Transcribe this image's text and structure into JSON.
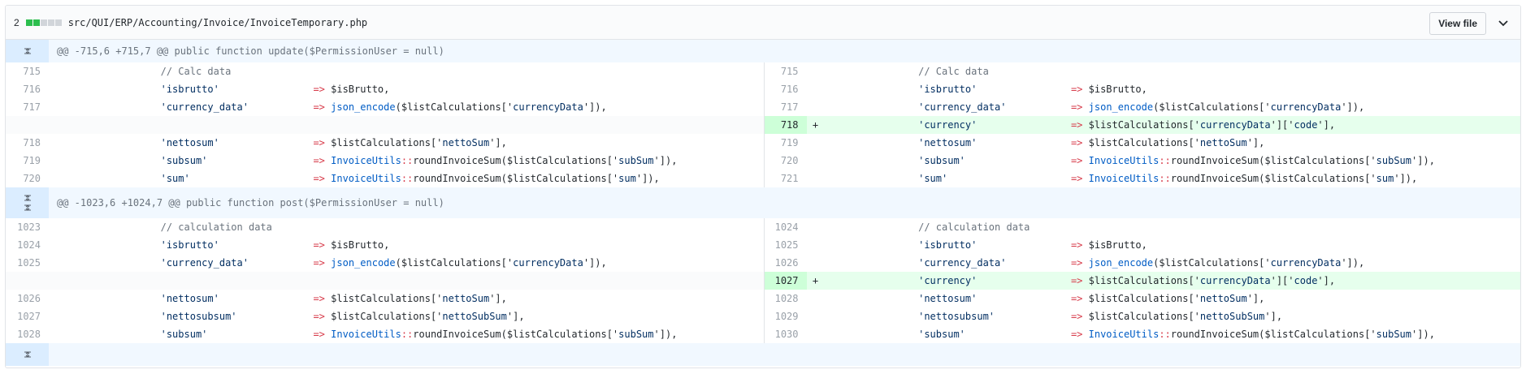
{
  "file": {
    "change_count": "2",
    "path": "src/QUI/ERP/Accounting/Invoice/InvoiceTemporary.php",
    "view_file_label": "View file",
    "diffstat": [
      "#2cbe4e",
      "#2cbe4e",
      "#d1d5da",
      "#d1d5da",
      "#d1d5da"
    ]
  },
  "hunks": [
    {
      "header": "@@ -715,6 +715,7 @@ public function update($PermissionUser = null)",
      "rows": [
        {
          "l": "715",
          "r": "715",
          "key": "",
          "comment": "// Calc data",
          "type": "ctx"
        },
        {
          "l": "716",
          "r": "716",
          "key": "'isbrutto'",
          "val": "$isBrutto,",
          "type": "ctx"
        },
        {
          "l": "717",
          "r": "717",
          "key": "'currency_data'",
          "fn": "json_encode",
          "val": "($listCalculations['",
          "strv": "currencyData",
          "tail": "']),",
          "type": "ctx"
        },
        {
          "l": "",
          "r": "718",
          "key": "'currency'",
          "val": "$listCalculations['",
          "strv": "currencyData",
          "tail": "']['",
          "strv2": "code",
          "tail2": "'],",
          "type": "add"
        },
        {
          "l": "718",
          "r": "719",
          "key": "'nettosum'",
          "val": "$listCalculations['",
          "strv": "nettoSum",
          "tail": "'],",
          "type": "ctx"
        },
        {
          "l": "719",
          "r": "720",
          "key": "'subsum'",
          "cls": "InvoiceUtils",
          "val": "roundInvoiceSum($listCalculations['",
          "strv": "subSum",
          "tail": "']),",
          "type": "ctx"
        },
        {
          "l": "720",
          "r": "721",
          "key": "'sum'",
          "cls": "InvoiceUtils",
          "val": "roundInvoiceSum($listCalculations['",
          "strv": "sum",
          "tail": "']),",
          "type": "ctx"
        }
      ]
    },
    {
      "header": "@@ -1023,6 +1024,7 @@ public function post($PermissionUser = null)",
      "rows": [
        {
          "l": "1023",
          "r": "1024",
          "key": "",
          "comment": "// calculation data",
          "type": "ctx"
        },
        {
          "l": "1024",
          "r": "1025",
          "key": "'isbrutto'",
          "val": "$isBrutto,",
          "type": "ctx"
        },
        {
          "l": "1025",
          "r": "1026",
          "key": "'currency_data'",
          "fn": "json_encode",
          "val": "($listCalculations['",
          "strv": "currencyData",
          "tail": "']),",
          "type": "ctx"
        },
        {
          "l": "",
          "r": "1027",
          "key": "'currency'",
          "val": "$listCalculations['",
          "strv": "currencyData",
          "tail": "']['",
          "strv2": "code",
          "tail2": "'],",
          "type": "add"
        },
        {
          "l": "1026",
          "r": "1028",
          "key": "'nettosum'",
          "val": "$listCalculations['",
          "strv": "nettoSum",
          "tail": "'],",
          "type": "ctx"
        },
        {
          "l": "1027",
          "r": "1029",
          "key": "'nettosubsum'",
          "val": "$listCalculations['",
          "strv": "nettoSubSum",
          "tail": "'],",
          "type": "ctx"
        },
        {
          "l": "1028",
          "r": "1030",
          "key": "'subsum'",
          "cls": "InvoiceUtils",
          "val": "roundInvoiceSum($listCalculations['",
          "strv": "subSum",
          "tail": "']),",
          "type": "ctx"
        }
      ]
    }
  ],
  "plus_marker": "+",
  "arrow": "=>",
  "scope_op": "::",
  "colors": {
    "added_bg": "#e6ffed",
    "added_num_bg": "#cdffd8",
    "hunk_bg": "#f1f8ff",
    "expander_bg": "#dbedff"
  }
}
